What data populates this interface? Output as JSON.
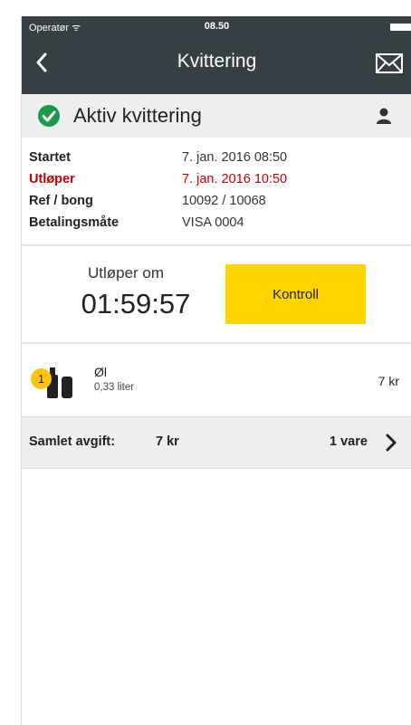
{
  "status_bar": {
    "carrier": "Operatør ᯤ",
    "time": "08.50"
  },
  "header": {
    "title": "Kvittering"
  },
  "status_band": {
    "text": "Aktiv kvittering"
  },
  "info": [
    {
      "label": "Startet",
      "value": "7. jan. 2016 08:50",
      "highlight": false
    },
    {
      "label": "Utløper",
      "value": "7. jan. 2016 10:50",
      "highlight": true
    },
    {
      "label": "Ref / bong",
      "value": "10092 / 10068",
      "highlight": false
    },
    {
      "label": "Betalingsmåte",
      "value": "VISA 0004",
      "highlight": false
    }
  ],
  "countdown": {
    "label": "Utløper om",
    "time": "01:59:57"
  },
  "kontroll_button": "Kontroll",
  "product": {
    "quantity": "1",
    "name": "Øl",
    "volume": "0,33 liter",
    "price": "7 kr"
  },
  "summary": {
    "label": "Samlet avgift:",
    "total": "7 kr",
    "count": "1 vare"
  },
  "colors": {
    "header_bg": "#363f43",
    "accent": "#ffd400",
    "warning": "#c00000",
    "success": "#1a9b48"
  },
  "icons": [
    "back-arrow-icon",
    "mail-icon",
    "check-circle-icon",
    "user-icon",
    "bottle-icon",
    "chevron-right-icon"
  ]
}
